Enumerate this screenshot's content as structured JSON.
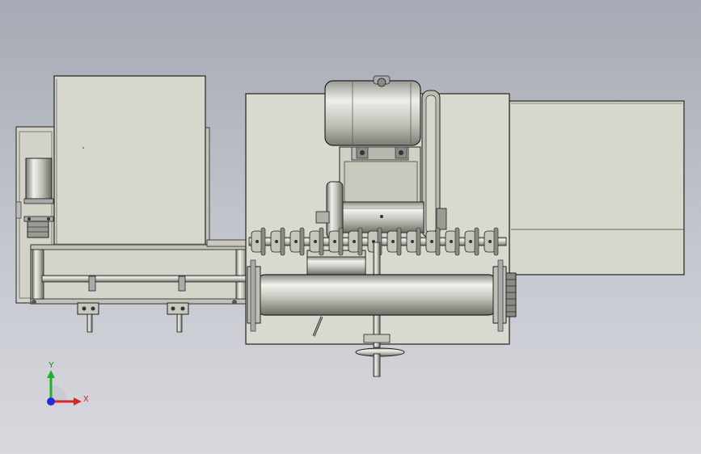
{
  "viewport": {
    "background_top": "#a6aab4",
    "background_bottom": "#d7d9de"
  },
  "triad": {
    "x_label": "X",
    "y_label": "Y",
    "x_color": "#d8262a",
    "y_color": "#20b030",
    "z_color": "#1e2fd6"
  },
  "colors": {
    "part_fill": "#d6d6cc",
    "part_fill_dark": "#c6c6bc",
    "edge": "#222222",
    "metal_light": "#eeeeea",
    "metal_mid": "#b8b8b0",
    "metal_dark": "#70706a"
  },
  "icons": [
    "motor-icon",
    "roller-icon",
    "handwheel-icon",
    "sprocket-icon",
    "coordinate-triad-icon"
  ]
}
